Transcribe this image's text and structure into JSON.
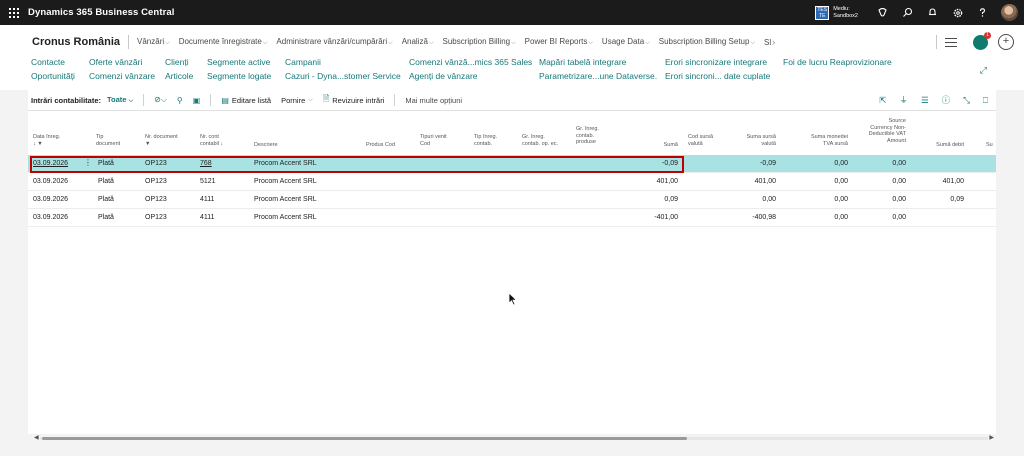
{
  "topbar": {
    "title": "Dynamics 365 Business Central",
    "env_badge": "TES TE",
    "env_line1": "Mediu:",
    "env_line2": "Sandbox2"
  },
  "header": {
    "company": "Cronus România",
    "menus": [
      "Vânzări",
      "Documente înregistrate",
      "Administrare vânzări/cumpărări",
      "Analiză",
      "Subscription Billing",
      "Power BI Reports",
      "Usage Data",
      "Subscription Billing Setup",
      "Sl"
    ],
    "copilot_badge": "1",
    "links_row1": [
      "Contacte",
      "Oferte vânzări",
      "Clienți",
      "Segmente active",
      "Campanii",
      "Comenzi vânză...mics 365 Sales",
      "Mapări tabelă integrare",
      "Erori sincronizare integrare",
      "Foi de lucru Reaprovizionare"
    ],
    "links_row2": [
      "Oportunități",
      "Comenzi vânzare",
      "Articole",
      "Segmente logate",
      "Cazuri - Dyna...stomer Service",
      "Agenți de vânzare",
      "Parametrizare...une Dataverse.",
      "Erori sincroni... date cuplate"
    ]
  },
  "action_bar": {
    "title": "Intrări contabilitate:",
    "filter": "Toate",
    "edit_list": "Editare listă",
    "start": "Pornire",
    "review": "Revizuire intrări",
    "more": "Mai multe opțiuni"
  },
  "columns": {
    "c1": "Data înreg.",
    "c2a": "Tip",
    "c2b": "document",
    "c3": "Nr. document",
    "c4a": "Nr. cont",
    "c4b": "contabil ↓",
    "c5": "Descriere",
    "c6": "Produs Cod",
    "c7a": "Tipuri venit",
    "c7b": "Cod",
    "c8a": "Tip înreg.",
    "c8b": "contab.",
    "c9a": "Gr. înreg.",
    "c9b": "contab. op. ec.",
    "c10a": "Gr. înreg.",
    "c10b": "contab.",
    "c10c": "produse",
    "c11": "Sumă",
    "c12a": "Cod sursă",
    "c12b": "valută",
    "c13a": "Suma sursă",
    "c13b": "valută",
    "c14a": "Suma monedei",
    "c14b": "TVA sursă",
    "c15a": "Source",
    "c15b": "Currency Non-",
    "c15c": "Deductible VAT",
    "c15d": "Amount",
    "c16": "Sumă debit",
    "c17": "Su"
  },
  "rows": [
    {
      "date": "03.09.2026",
      "type": "Plată",
      "doc": "OP123",
      "account": "768",
      "desc": "Procom Accent SRL",
      "amount": "-0,09",
      "src_amount": "-0,09",
      "vat_src": "0,00",
      "nondeduct": "0,00",
      "debit": ""
    },
    {
      "date": "03.09.2026",
      "type": "Plată",
      "doc": "OP123",
      "account": "5121",
      "desc": "Procom Accent SRL",
      "amount": "401,00",
      "src_amount": "401,00",
      "vat_src": "0,00",
      "nondeduct": "0,00",
      "debit": "401,00"
    },
    {
      "date": "03.09.2026",
      "type": "Plată",
      "doc": "OP123",
      "account": "4111",
      "desc": "Procom Accent SRL",
      "amount": "0,09",
      "src_amount": "0,00",
      "vat_src": "0,00",
      "nondeduct": "0,00",
      "debit": "0,09"
    },
    {
      "date": "03.09.2026",
      "type": "Plată",
      "doc": "OP123",
      "account": "4111",
      "desc": "Procom Accent SRL",
      "amount": "-401,00",
      "src_amount": "-400,98",
      "vat_src": "0,00",
      "nondeduct": "0,00",
      "debit": ""
    }
  ],
  "icons": {
    "top": [
      "copilot-icon",
      "search-icon",
      "bell-icon",
      "settings-icon",
      "help-icon"
    ],
    "action_right": [
      "share-icon",
      "filter-icon",
      "list-view-icon",
      "info-icon",
      "collapse-icon",
      "bookmark-icon"
    ]
  },
  "colors": {
    "accent": "#15787a",
    "selected_row": "#a9e2e2",
    "highlight_border": "#c00000"
  }
}
